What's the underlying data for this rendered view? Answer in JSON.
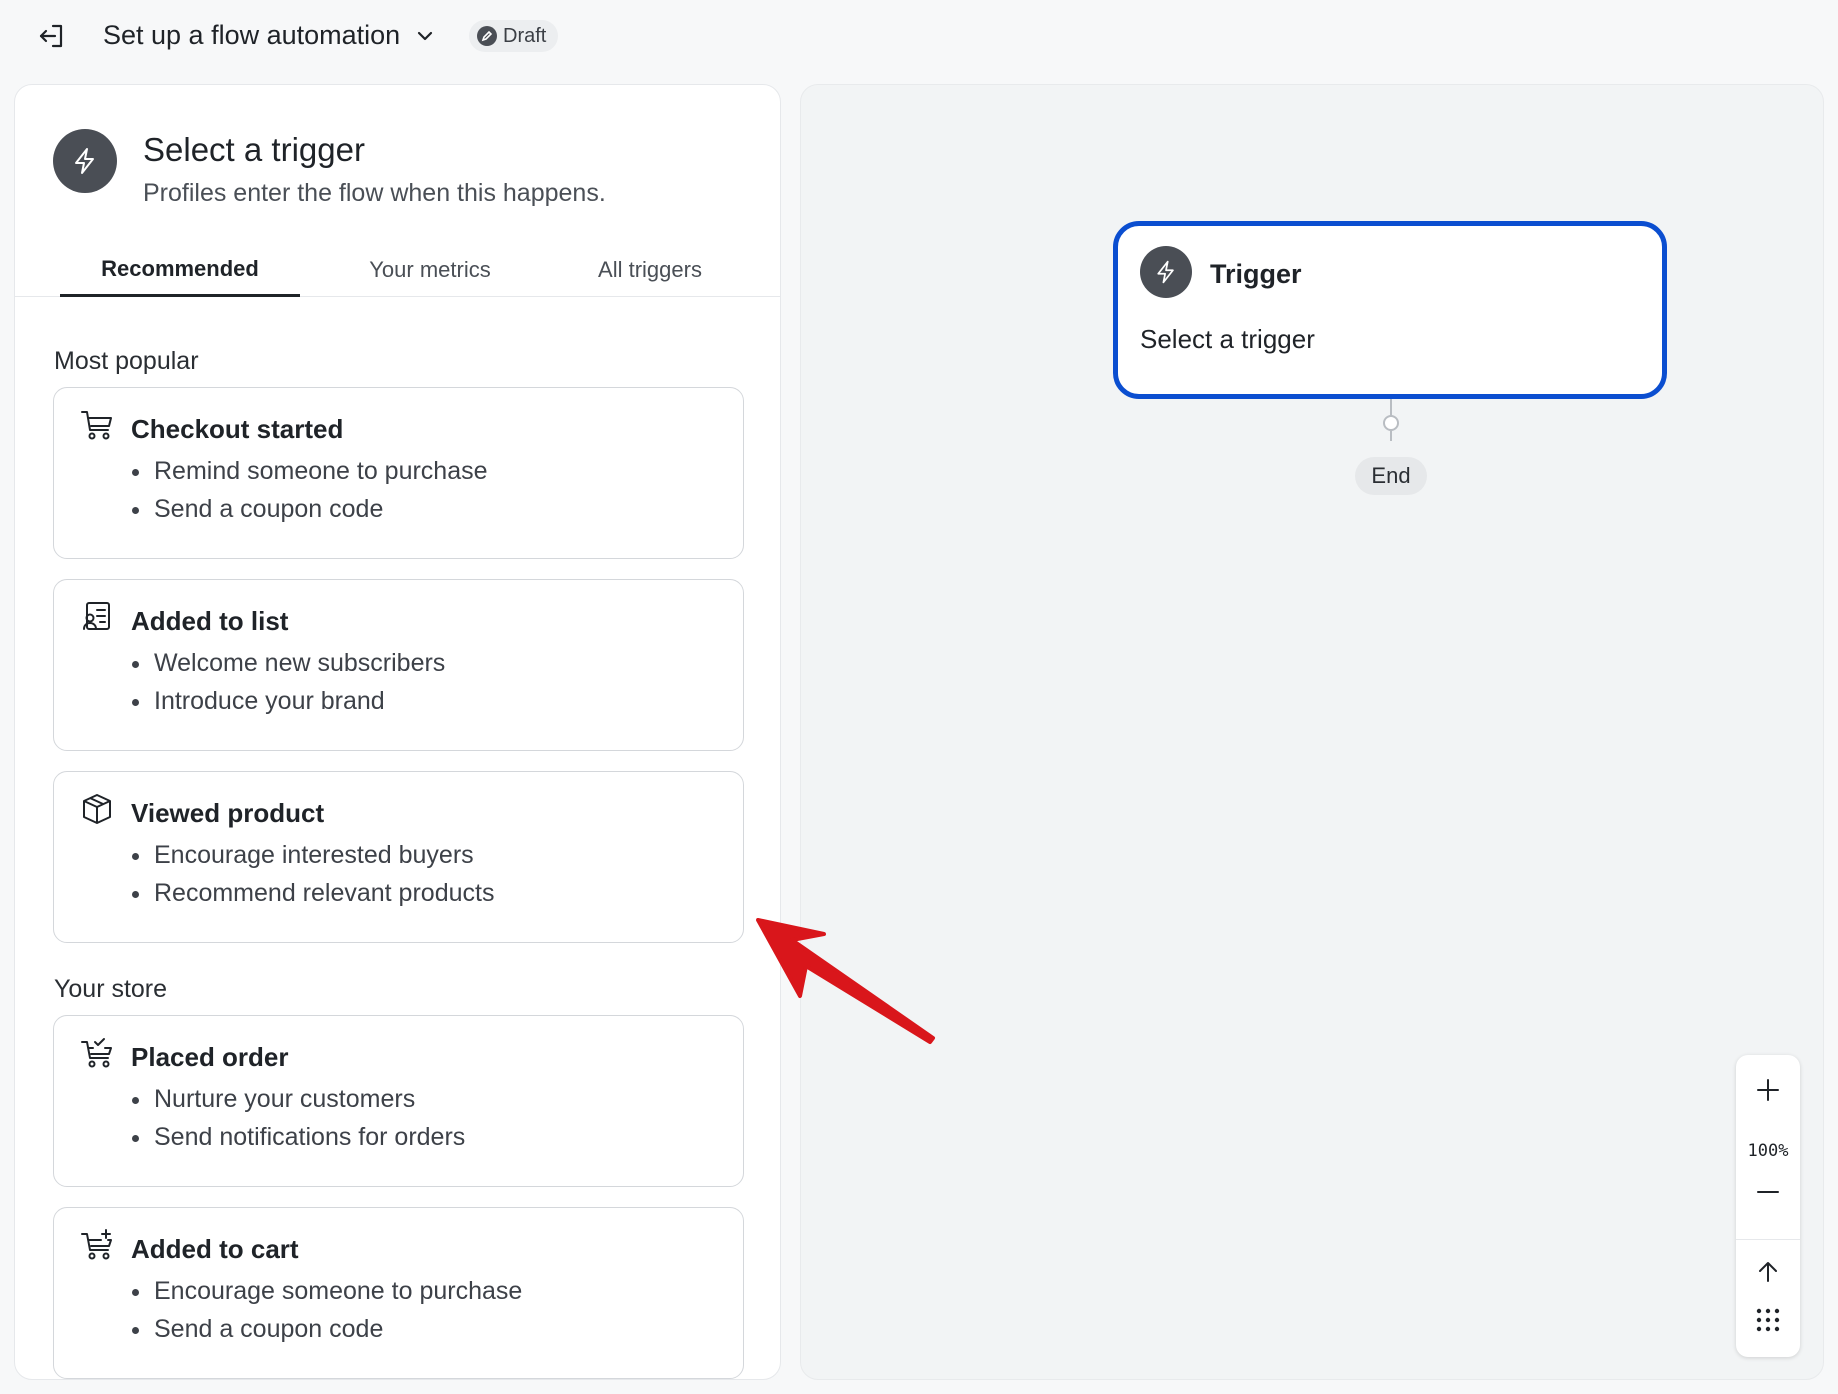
{
  "header": {
    "title": "Set up a flow automation",
    "status": "Draft"
  },
  "panel": {
    "title": "Select a trigger",
    "subtitle": "Profiles enter the flow when this happens.",
    "tabs": [
      "Recommended",
      "Your metrics",
      "All triggers"
    ],
    "active_tab": "Recommended",
    "sections": {
      "popular_label": "Most popular",
      "store_label": "Your store"
    },
    "cards": [
      {
        "icon": "cart-icon",
        "title": "Checkout started",
        "bullets": [
          "Remind someone to purchase",
          "Send a coupon code"
        ]
      },
      {
        "icon": "list-contact-icon",
        "title": "Added to list",
        "bullets": [
          "Welcome new subscribers",
          "Introduce your brand"
        ]
      },
      {
        "icon": "box-icon",
        "title": "Viewed product",
        "bullets": [
          "Encourage interested buyers",
          "Recommend relevant products"
        ]
      },
      {
        "icon": "cart-check-icon",
        "title": "Placed order",
        "bullets": [
          "Nurture your customers",
          "Send notifications for orders"
        ]
      },
      {
        "icon": "cart-plus-icon",
        "title": "Added to cart",
        "bullets": [
          "Encourage someone to purchase",
          "Send a coupon code"
        ]
      }
    ]
  },
  "canvas": {
    "node": {
      "title": "Trigger",
      "subtitle": "Select a trigger"
    },
    "end_label": "End",
    "zoom_level": "100%"
  },
  "colors": {
    "accent": "#0b4ed0",
    "annotation_arrow": "#d9161b"
  }
}
